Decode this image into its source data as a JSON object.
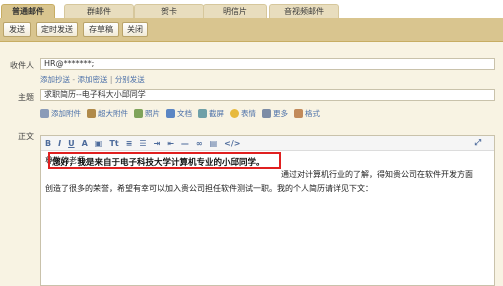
{
  "tabs": [
    {
      "label": "普通邮件",
      "active": true
    },
    {
      "label": "群邮件",
      "active": false
    },
    {
      "label": "贺卡",
      "active": false
    },
    {
      "label": "明信片",
      "active": false
    },
    {
      "label": "音视频邮件",
      "active": false
    }
  ],
  "toolbar": {
    "send": "发送",
    "timed_send": "定时发送",
    "draft": "存草稿",
    "close": "关闭"
  },
  "recipient": {
    "label": "收件人",
    "value": "HR@*******;"
  },
  "recipient_links": {
    "add_cc": "添加抄送",
    "add_bcc": "添加密送",
    "separate_send": "分别发送",
    "dash": "-",
    "pipe": "|"
  },
  "subject": {
    "label": "主题",
    "value": "求职简历--电子科大小邱同学"
  },
  "attach_bar": {
    "add_attachment": "添加附件",
    "large_attachment": "超大附件",
    "photo": "照片",
    "document": "文档",
    "screenshot": "截屏",
    "emoji": "表情",
    "more": "更多",
    "format": "格式"
  },
  "body": {
    "label": "正文",
    "greeting": "尊敬的老师:",
    "highlight": "您好，我是来自于电子科技大学计算机专业的小邱同学。",
    "line1_rest": "通过对计算机行业的了解，得知贵公司在软件开发方面",
    "line2": "创造了很多的荣誉，希望有幸可以加入贵公司担任软件测试一职。我的个人简历请详见下文："
  },
  "colors": {
    "tab_bg": "#e8ddbe",
    "toolbar_bg": "#d9c58f",
    "form_bg": "#f8f3e3",
    "link": "#4a6fa8",
    "highlight_border": "#e02020"
  }
}
